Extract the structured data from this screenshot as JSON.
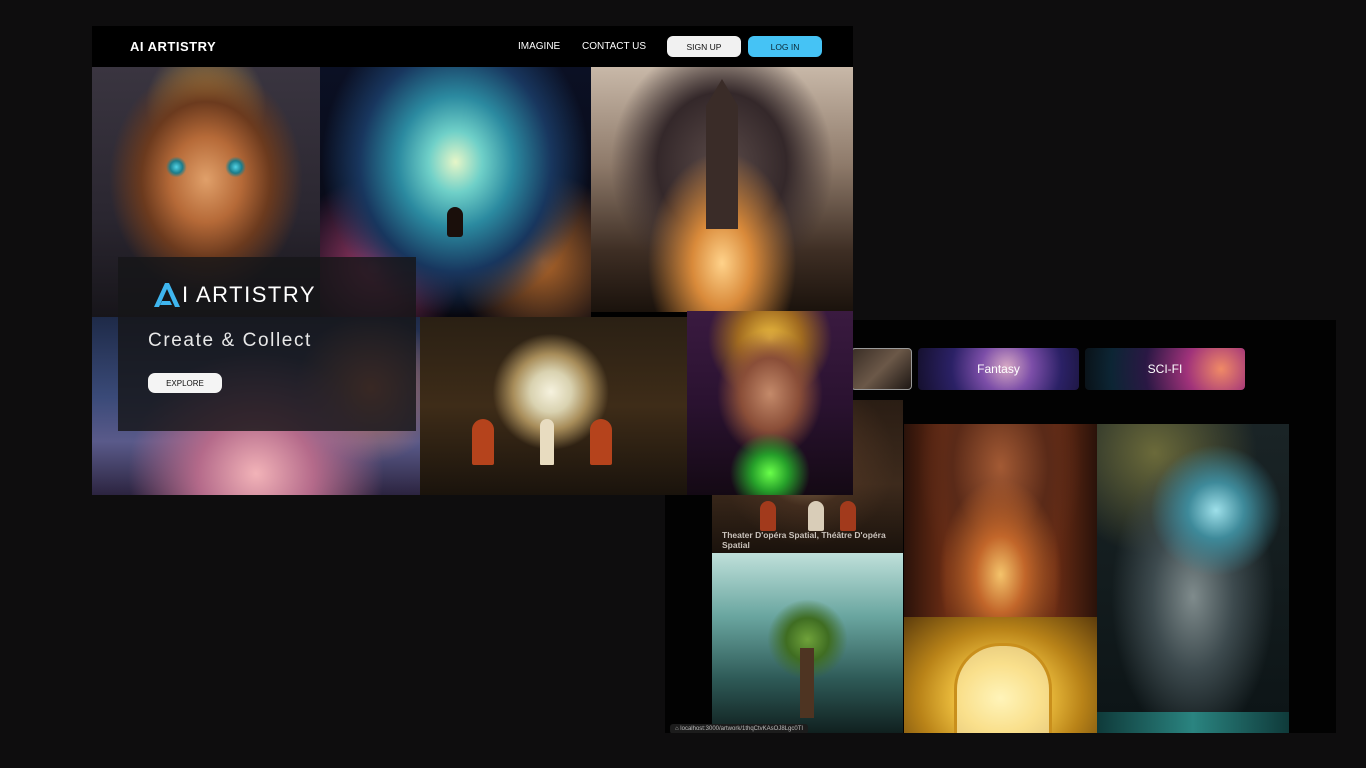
{
  "landing": {
    "brand": "AI ARTISTRY",
    "nav": {
      "imagine": "IMAGINE",
      "contact": "CONTACT US",
      "signup": "SIGN UP",
      "login": "LOG IN"
    },
    "hero": {
      "logo_text": "I ARTISTRY",
      "tagline": "Create & Collect",
      "cta": "EXPLORE"
    }
  },
  "gallery": {
    "categories": [
      {
        "label": ""
      },
      {
        "label": "Fantasy"
      },
      {
        "label": "SCI-FI"
      }
    ],
    "artworks": [
      {
        "title": "Theater D'opéra Spatial, Théâtre D'opéra Spatial"
      }
    ],
    "status_url": "localhost:3000/artwork/1thqCtvKAsOJ8Lgc0TI"
  },
  "colors": {
    "page_background": "#0e0d0e",
    "accent": "#45c3f5",
    "logo_mark": "#3fb6ef"
  }
}
